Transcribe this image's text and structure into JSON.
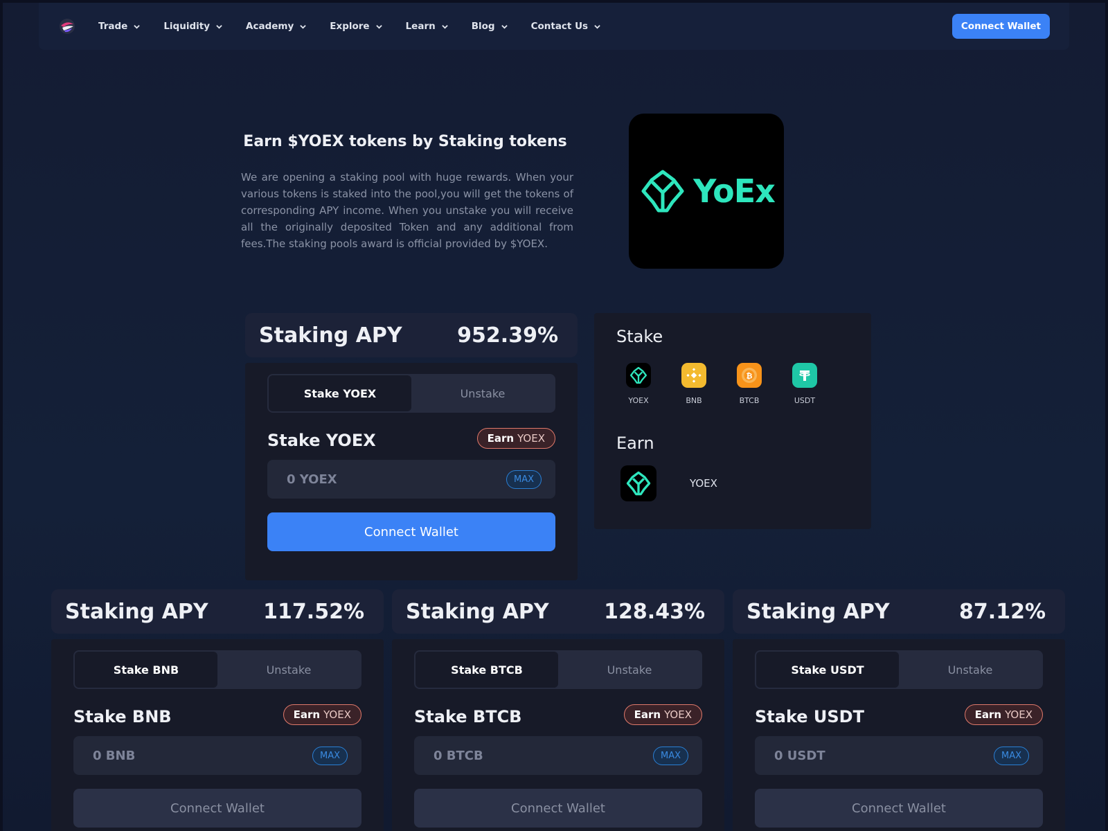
{
  "nav": {
    "items": [
      {
        "label": "Trade"
      },
      {
        "label": "Liquidity"
      },
      {
        "label": "Academy"
      },
      {
        "label": "Explore"
      },
      {
        "label": "Learn"
      },
      {
        "label": "Blog"
      },
      {
        "label": "Contact Us"
      }
    ],
    "connect_label": "Connect Wallet"
  },
  "hero": {
    "title": "Earn $YOEX tokens by Staking tokens",
    "description": "We are opening a staking pool with huge rewards. When your various tokens is staked into the pool,you will get the tokens of corresponding APY income. When you unstake you will receive all the originally deposited Token and any additional from fees.The staking pools award is official provided by $YOEX.",
    "logo_text": "YoEx"
  },
  "pools": [
    {
      "apy_label": "Staking APY",
      "apy": "952.39%",
      "tab_stake": "Stake YOEX",
      "tab_unstake": "Unstake",
      "title": "Stake YOEX",
      "earn_word": "Earn",
      "earn_token": "YOEX",
      "placeholder": "0 YOEX",
      "max": "MAX",
      "connect": "Connect Wallet"
    },
    {
      "apy_label": "Staking APY",
      "apy": "117.52%",
      "tab_stake": "Stake BNB",
      "tab_unstake": "Unstake",
      "title": "Stake BNB",
      "earn_word": "Earn",
      "earn_token": "YOEX",
      "placeholder": "0 BNB",
      "max": "MAX",
      "connect": "Connect Wallet"
    },
    {
      "apy_label": "Staking APY",
      "apy": "128.43%",
      "tab_stake": "Stake BTCB",
      "tab_unstake": "Unstake",
      "title": "Stake BTCB",
      "earn_word": "Earn",
      "earn_token": "YOEX",
      "placeholder": "0 BTCB",
      "max": "MAX",
      "connect": "Connect Wallet"
    },
    {
      "apy_label": "Staking APY",
      "apy": "87.12%",
      "tab_stake": "Stake USDT",
      "tab_unstake": "Unstake",
      "title": "Stake USDT",
      "earn_word": "Earn",
      "earn_token": "YOEX",
      "placeholder": "0 USDT",
      "max": "MAX",
      "connect": "Connect Wallet"
    }
  ],
  "side": {
    "stake_heading": "Stake",
    "tokens": [
      {
        "label": "YOEX",
        "icon": "yoex-icon",
        "color": "#000000"
      },
      {
        "label": "BNB",
        "icon": "bnb-icon",
        "color": "#f3ba2f"
      },
      {
        "label": "BTCB",
        "icon": "btcb-icon",
        "color": "#f7931a"
      },
      {
        "label": "USDT",
        "icon": "usdt-icon",
        "color": "#26a17b"
      }
    ],
    "earn_heading": "Earn",
    "earn_token": "YOEX"
  },
  "colors": {
    "accent": "#3b82f6",
    "brand": "#2ee6bd",
    "badge_border": "#e0796b"
  }
}
